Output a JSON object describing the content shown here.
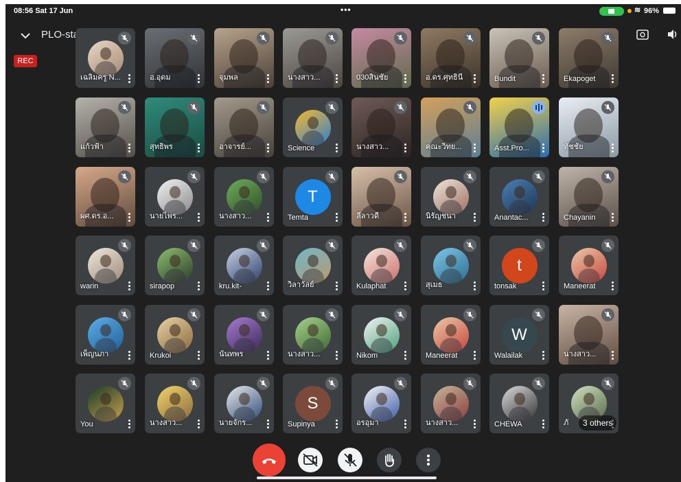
{
  "status": {
    "time": "08:56  Sat 17 Jun",
    "battery": "96%"
  },
  "header": {
    "title": "PLO-stakeholder",
    "rec": "REC"
  },
  "colors": {
    "background": "#1f1f20",
    "tile": "#3c4043",
    "rec": "#c5221f",
    "hangup": "#ea4335"
  },
  "participants": [
    {
      "name": "เฉลิมครู N...",
      "kind": "avatar",
      "c1": "#e9d8c8",
      "c2": "#a58a72"
    },
    {
      "name": "อ.อุดม",
      "kind": "camera",
      "c1": "#6b6f74",
      "c2": "#2f3236"
    },
    {
      "name": "จุมพล",
      "kind": "camera",
      "c1": "#b8a38c",
      "c2": "#4b4037"
    },
    {
      "name": "นางสาว...",
      "kind": "camera",
      "c1": "#9c9a96",
      "c2": "#4a4640"
    },
    {
      "name": "030สินชัย",
      "kind": "camera",
      "c1": "#c68aa3",
      "c2": "#5e6a4a"
    },
    {
      "name": "อ.ดร.ศุทธินี",
      "kind": "camera",
      "c1": "#8f7a62",
      "c2": "#3c3329"
    },
    {
      "name": "Bundit",
      "kind": "camera",
      "c1": "#c9c3b8",
      "c2": "#6a5b4e"
    },
    {
      "name": "Ekapoget",
      "kind": "camera",
      "c1": "#8d7c69",
      "c2": "#3e3a34"
    },
    {
      "name": "แก้วฟ้า",
      "kind": "camera",
      "c1": "#b5b2ab",
      "c2": "#545049"
    },
    {
      "name": "สุทธิพร",
      "kind": "camera",
      "c1": "#2f8c7b",
      "c2": "#1b4a42"
    },
    {
      "name": "อาจารย์...",
      "kind": "camera",
      "c1": "#a39a8c",
      "c2": "#46413a"
    },
    {
      "name": "Science",
      "kind": "avatar",
      "c1": "#f5b82e",
      "c2": "#2f7fd0"
    },
    {
      "name": "นางสาว...",
      "kind": "camera",
      "c1": "#6e5a55",
      "c2": "#2d2523"
    },
    {
      "name": "คณะวิทย...",
      "kind": "camera",
      "c1": "#d4a05a",
      "c2": "#5c7f96"
    },
    {
      "name": "Asst.Pro...",
      "kind": "camera",
      "c1": "#f2d24a",
      "c2": "#2b6cb0",
      "speaking": true
    },
    {
      "name": "ทัชชัย",
      "kind": "camera",
      "c1": "#e9eef2",
      "c2": "#8a98a5"
    },
    {
      "name": "ผศ.ดร.อ...",
      "kind": "camera",
      "c1": "#d7a98a",
      "c2": "#5e4a3c"
    },
    {
      "name": "นายไพร...",
      "kind": "avatar",
      "c1": "#f2f2f2",
      "c2": "#8a8a8a"
    },
    {
      "name": "นางสาว...",
      "kind": "avatar",
      "c1": "#6fae5a",
      "c2": "#2f4d2a"
    },
    {
      "name": "Temta",
      "kind": "letter",
      "letter": "T",
      "c1": "#1e88e5"
    },
    {
      "name": "ลีลาวดี",
      "kind": "camera",
      "c1": "#d6c0aa",
      "c2": "#6b5444"
    },
    {
      "name": "นิรัญชนา",
      "kind": "avatar",
      "c1": "#f0e4dc",
      "c2": "#9a6f60"
    },
    {
      "name": "Anantac...",
      "kind": "avatar",
      "c1": "#4a7fb5",
      "c2": "#1d3550"
    },
    {
      "name": "Chayanin",
      "kind": "camera",
      "c1": "#bfb4a9",
      "c2": "#5b5048"
    },
    {
      "name": "warin",
      "kind": "avatar",
      "c1": "#efe8df",
      "c2": "#9c8a76"
    },
    {
      "name": "sirapop",
      "kind": "avatar",
      "c1": "#8cbf6f",
      "c2": "#2c3a2a"
    },
    {
      "name": "kru.kit-",
      "kind": "avatar",
      "c1": "#c7d3e6",
      "c2": "#2b3e6b"
    },
    {
      "name": "วิลาวัลย์",
      "kind": "avatar",
      "c1": "#6fb7c9",
      "c2": "#b99a6d"
    },
    {
      "name": "Kulaphat",
      "kind": "avatar",
      "c1": "#f4e6dc",
      "c2": "#c96f6a"
    },
    {
      "name": "สุเมธ",
      "kind": "avatar",
      "c1": "#7fc6e8",
      "c2": "#2a6d8f"
    },
    {
      "name": "tonsak",
      "kind": "letter",
      "letter": "t",
      "c1": "#d2461b"
    },
    {
      "name": "Maneerat",
      "kind": "avatar",
      "c1": "#e9c9a8",
      "c2": "#c8453b"
    },
    {
      "name": "เพ็ญนภา",
      "kind": "avatar",
      "c1": "#5eaee8",
      "c2": "#1f5f96"
    },
    {
      "name": "Krukoi",
      "kind": "avatar",
      "c1": "#e8d2a6",
      "c2": "#8a6a3e"
    },
    {
      "name": "นันทพร",
      "kind": "avatar",
      "c1": "#a77bd0",
      "c2": "#3b2a58"
    },
    {
      "name": "นางสาว...",
      "kind": "avatar",
      "c1": "#a7d08a",
      "c2": "#3e6b33"
    },
    {
      "name": "Nikom",
      "kind": "avatar",
      "c1": "#f3f3f3",
      "c2": "#4aa07a"
    },
    {
      "name": "Maneerat",
      "kind": "avatar",
      "c1": "#e9c9a8",
      "c2": "#c8453b"
    },
    {
      "name": "Walailak",
      "kind": "letter",
      "letter": "W",
      "c1": "#37474f"
    },
    {
      "name": "นางสาว...",
      "kind": "camera",
      "c1": "#c9b4a4",
      "c2": "#5e4c40"
    },
    {
      "name": "You",
      "kind": "avatar",
      "c1": "#1b3a2a",
      "c2": "#c6a14a"
    },
    {
      "name": "นางสาว...",
      "kind": "avatar",
      "c1": "#f0d46a",
      "c2": "#8a6a3e"
    },
    {
      "name": "นายจักร...",
      "kind": "avatar",
      "c1": "#e9e9e9",
      "c2": "#2b4a7a"
    },
    {
      "name": "Supinya",
      "kind": "letter",
      "letter": "S",
      "c1": "#7b4a3a"
    },
    {
      "name": "อรอุมา",
      "kind": "avatar",
      "c1": "#f5f5f5",
      "c2": "#3b5aa8"
    },
    {
      "name": "นางสาว...",
      "kind": "avatar",
      "c1": "#c7b59a",
      "c2": "#8a3d3d"
    },
    {
      "name": "CHEWA",
      "kind": "avatar",
      "c1": "#d9d9d9",
      "c2": "#333333"
    },
    {
      "name": "ภั",
      "kind": "avatar",
      "c1": "#cfe0c0",
      "c2": "#5a6b4a"
    }
  ],
  "others_label": "3 others",
  "controls": {
    "hangup": "hangup-icon",
    "camera": "camera-off-icon",
    "mic": "mic-off-icon",
    "hand": "raise-hand-icon",
    "more": "more-options-icon"
  }
}
